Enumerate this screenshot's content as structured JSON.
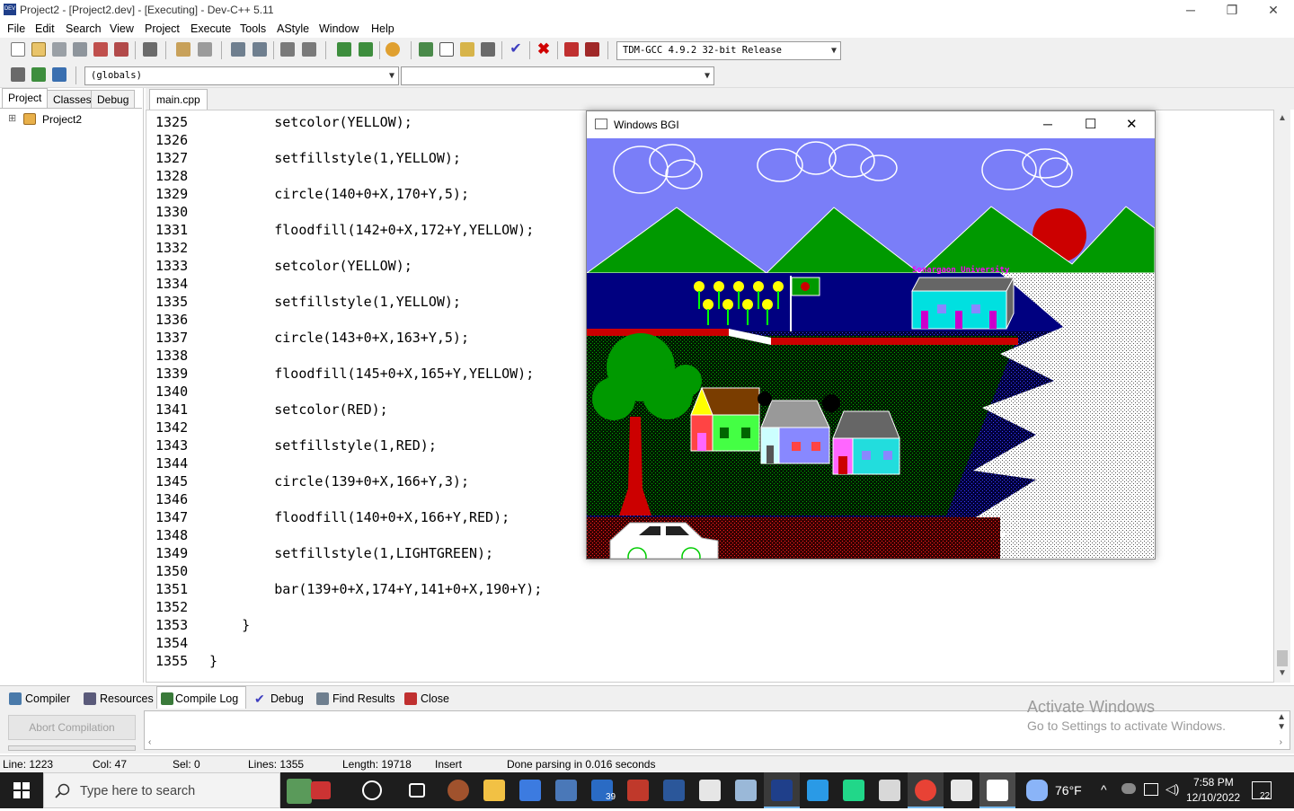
{
  "window": {
    "title": "Project2 - [Project2.dev] - [Executing] - Dev-C++ 5.11",
    "app_icon_text": "DEV",
    "minimize": "─",
    "restore": "❐",
    "close": "✕"
  },
  "menu": [
    "File",
    "Edit",
    "Search",
    "View",
    "Project",
    "Execute",
    "Tools",
    "AStyle",
    "Window",
    "Help"
  ],
  "toolbar": {
    "compiler_select": "TDM-GCC 4.9.2 32-bit Release",
    "scope_select": "(globals)",
    "member_select": ""
  },
  "left_panel": {
    "tabs": [
      "Project",
      "Classes",
      "Debug"
    ],
    "tree_expander": "⊞",
    "tree_root": "Project2"
  },
  "editor": {
    "tab": "main.cpp",
    "lines": [
      {
        "n": "1325",
        "code": "        setcolor(YELLOW);"
      },
      {
        "n": "1326",
        "code": ""
      },
      {
        "n": "1327",
        "code": "        setfillstyle(1,YELLOW);"
      },
      {
        "n": "1328",
        "code": ""
      },
      {
        "n": "1329",
        "code": "        circle(140+0+X,170+Y,5);"
      },
      {
        "n": "1330",
        "code": ""
      },
      {
        "n": "1331",
        "code": "        floodfill(142+0+X,172+Y,YELLOW);"
      },
      {
        "n": "1332",
        "code": ""
      },
      {
        "n": "1333",
        "code": "        setcolor(YELLOW);"
      },
      {
        "n": "1334",
        "code": ""
      },
      {
        "n": "1335",
        "code": "        setfillstyle(1,YELLOW);"
      },
      {
        "n": "1336",
        "code": ""
      },
      {
        "n": "1337",
        "code": "        circle(143+0+X,163+Y,5);"
      },
      {
        "n": "1338",
        "code": ""
      },
      {
        "n": "1339",
        "code": "        floodfill(145+0+X,165+Y,YELLOW);"
      },
      {
        "n": "1340",
        "code": ""
      },
      {
        "n": "1341",
        "code": "        setcolor(RED);"
      },
      {
        "n": "1342",
        "code": ""
      },
      {
        "n": "1343",
        "code": "        setfillstyle(1,RED);"
      },
      {
        "n": "1344",
        "code": ""
      },
      {
        "n": "1345",
        "code": "        circle(139+0+X,166+Y,3);"
      },
      {
        "n": "1346",
        "code": ""
      },
      {
        "n": "1347",
        "code": "        floodfill(140+0+X,166+Y,RED);"
      },
      {
        "n": "1348",
        "code": ""
      },
      {
        "n": "1349",
        "code": "        setfillstyle(1,LIGHTGREEN);"
      },
      {
        "n": "1350",
        "code": ""
      },
      {
        "n": "1351",
        "code": "        bar(139+0+X,174+Y,141+0+X,190+Y);"
      },
      {
        "n": "1352",
        "code": ""
      },
      {
        "n": "1353",
        "code": "    }"
      },
      {
        "n": "1354",
        "code": ""
      },
      {
        "n": "1355",
        "code": "}"
      }
    ]
  },
  "bgi_window": {
    "title": "Windows BGI",
    "minimize": "─",
    "maximize": "☐",
    "close": "✕",
    "banner": "Sonargaon University"
  },
  "bottom_tabs": [
    "Compiler",
    "Resources",
    "Compile Log",
    "Debug",
    "Find Results",
    "Close"
  ],
  "bottom_panel": {
    "abort_button": "Abort Compilation"
  },
  "watermark": {
    "line1": "Activate Windows",
    "line2": "Go to Settings to activate Windows."
  },
  "status": {
    "line": "Line:  1223",
    "col": "Col:   47",
    "sel": "Sel:    0",
    "lines": "Lines:  1355",
    "length": "Length:  19718",
    "mode": "Insert",
    "message": "Done parsing in 0.016 seconds"
  },
  "taskbar": {
    "search_placeholder": "Type here to search",
    "mail_badge": "39",
    "weather": "76°F",
    "time": "7:58 PM",
    "date": "12/10/2022",
    "notification_count": "22"
  },
  "colors": {
    "sky": "#7a7ef8",
    "grass": "#009900",
    "water": "#000080",
    "sun": "#cc0000",
    "taskbar": "#1d1d1d"
  }
}
